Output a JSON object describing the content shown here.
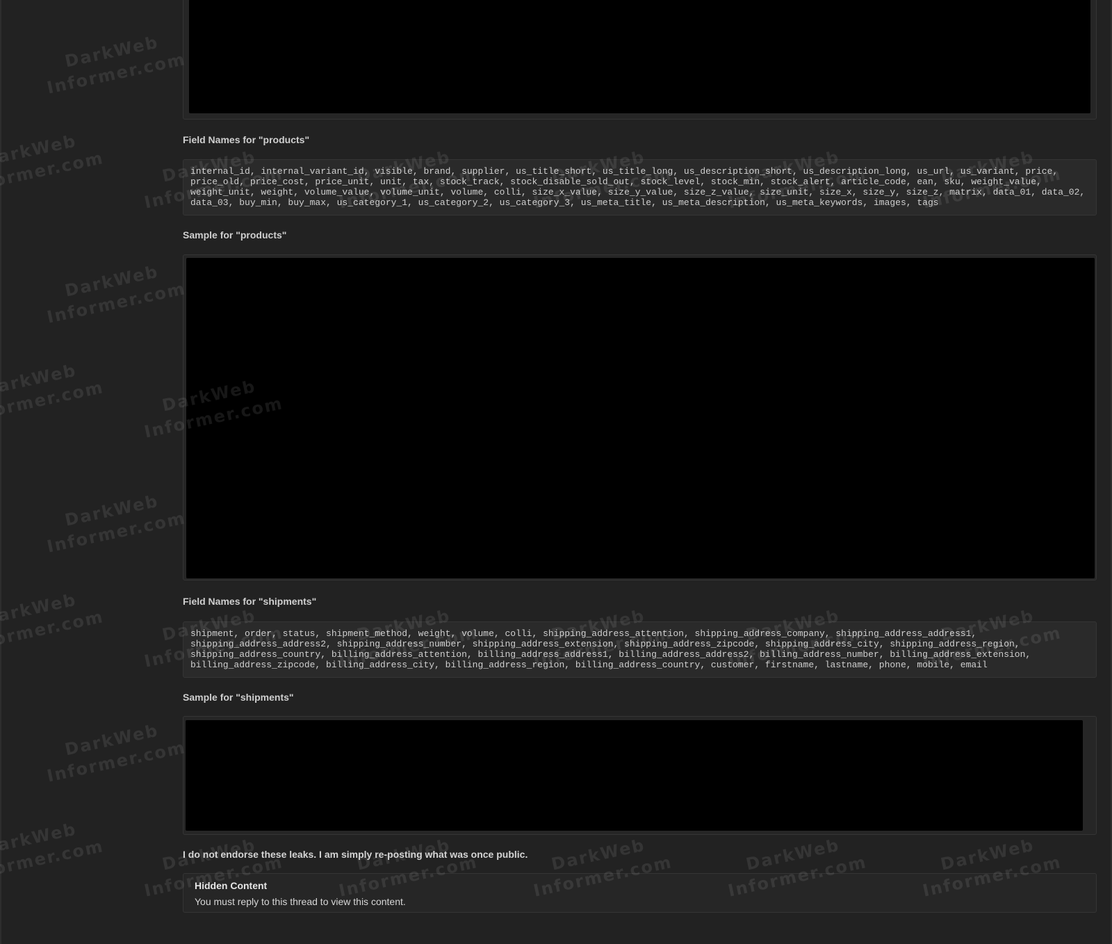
{
  "sections": {
    "products_fields_heading": "Field Names for \"products\"",
    "products_fields": "internal_id, internal_variant_id, visible, brand, supplier, us_title_short, us_title_long, us_description_short, us_description_long, us_url, us_variant, price, price_old, price_cost, price_unit, unit, tax, stock_track, stock_disable_sold_out, stock_level, stock_min, stock_alert, article_code, ean, sku, weight_value, weight_unit, weight, volume_value, volume_unit, volume, colli, size_x_value, size_y_value, size_z_value, size_unit, size_x, size_y, size_z, matrix, data_01, data_02, data_03, buy_min, buy_max, us_category_1, us_category_2, us_category_3, us_meta_title, us_meta_description, us_meta_keywords, images, tags",
    "products_sample_heading": "Sample for \"products\"",
    "shipments_fields_heading": "Field Names for \"shipments\"",
    "shipments_fields": "shipment, order, status, shipment_method, weight, volume, colli, shipping_address_attention, shipping_address_company, shipping_address_address1, shipping_address_address2, shipping_address_number, shipping_address_extension, shipping_address_zipcode, shipping_address_city, shipping_address_region, shipping_address_country, billing_address_attention, billing_address_address1, billing_address_address2, billing_address_number, billing_address_extension, billing_address_zipcode, billing_address_city, billing_address_region, billing_address_country, customer, firstname, lastname, phone, mobile, email",
    "shipments_sample_heading": "Sample for \"shipments\""
  },
  "disclaimer": "I do not endorse these leaks. I am simply re-posting what was once public.",
  "hidden_content": {
    "title": "Hidden Content",
    "message": "You must reply to this thread to view this content."
  },
  "watermark": {
    "line1": "DarkWeb",
    "line2": "Informer.com"
  }
}
